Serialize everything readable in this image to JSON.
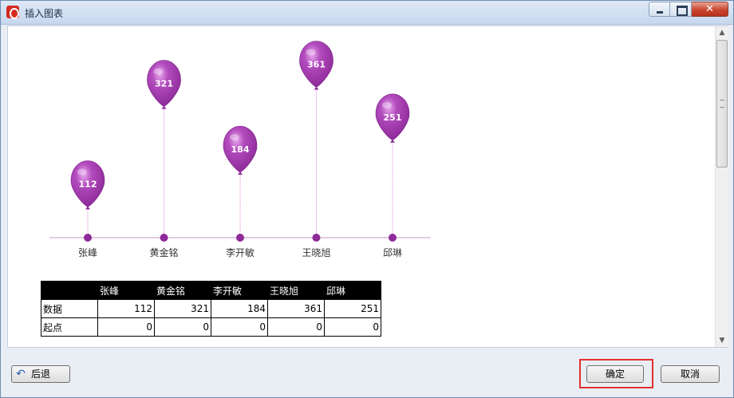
{
  "window": {
    "title": "插入图表"
  },
  "chart_data": {
    "type": "bar",
    "style": "balloon",
    "categories": [
      "张峰",
      "黄金铭",
      "李开敏",
      "王晓旭",
      "邱琳"
    ],
    "series": [
      {
        "name": "数据",
        "values": [
          112,
          321,
          184,
          361,
          251
        ]
      },
      {
        "name": "起点",
        "values": [
          0,
          0,
          0,
          0,
          0
        ]
      }
    ],
    "ylim": [
      0,
      400
    ],
    "title": "",
    "xlabel": "",
    "ylabel": "",
    "grid": false,
    "colors": {
      "balloon": "#8e2a99",
      "stem": "#e3a7e0",
      "axis": "#c994cc"
    }
  },
  "table": {
    "header": [
      "",
      "张峰",
      "黄金铭",
      "李开敏",
      "王晓旭",
      "邱琳"
    ],
    "rows": [
      {
        "label": "数据",
        "values": [
          "112",
          "321",
          "184",
          "361",
          "251"
        ]
      },
      {
        "label": "起点",
        "values": [
          "0",
          "0",
          "0",
          "0",
          "0"
        ]
      }
    ]
  },
  "buttons": {
    "back": "后退",
    "ok": "确定",
    "cancel": "取消"
  }
}
